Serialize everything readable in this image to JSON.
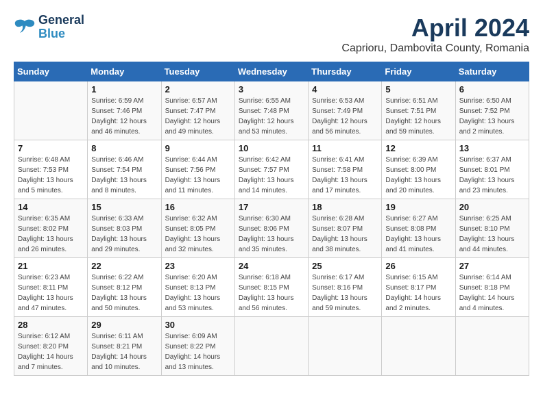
{
  "header": {
    "logo_line1": "General",
    "logo_line2": "Blue",
    "month": "April 2024",
    "location": "Caprioru, Dambovita County, Romania"
  },
  "weekdays": [
    "Sunday",
    "Monday",
    "Tuesday",
    "Wednesday",
    "Thursday",
    "Friday",
    "Saturday"
  ],
  "weeks": [
    [
      null,
      {
        "day": 1,
        "sunrise": "6:59 AM",
        "sunset": "7:46 PM",
        "daylight": "12 hours and 46 minutes."
      },
      {
        "day": 2,
        "sunrise": "6:57 AM",
        "sunset": "7:47 PM",
        "daylight": "12 hours and 49 minutes."
      },
      {
        "day": 3,
        "sunrise": "6:55 AM",
        "sunset": "7:48 PM",
        "daylight": "12 hours and 53 minutes."
      },
      {
        "day": 4,
        "sunrise": "6:53 AM",
        "sunset": "7:49 PM",
        "daylight": "12 hours and 56 minutes."
      },
      {
        "day": 5,
        "sunrise": "6:51 AM",
        "sunset": "7:51 PM",
        "daylight": "12 hours and 59 minutes."
      },
      {
        "day": 6,
        "sunrise": "6:50 AM",
        "sunset": "7:52 PM",
        "daylight": "13 hours and 2 minutes."
      }
    ],
    [
      {
        "day": 7,
        "sunrise": "6:48 AM",
        "sunset": "7:53 PM",
        "daylight": "13 hours and 5 minutes."
      },
      {
        "day": 8,
        "sunrise": "6:46 AM",
        "sunset": "7:54 PM",
        "daylight": "13 hours and 8 minutes."
      },
      {
        "day": 9,
        "sunrise": "6:44 AM",
        "sunset": "7:56 PM",
        "daylight": "13 hours and 11 minutes."
      },
      {
        "day": 10,
        "sunrise": "6:42 AM",
        "sunset": "7:57 PM",
        "daylight": "13 hours and 14 minutes."
      },
      {
        "day": 11,
        "sunrise": "6:41 AM",
        "sunset": "7:58 PM",
        "daylight": "13 hours and 17 minutes."
      },
      {
        "day": 12,
        "sunrise": "6:39 AM",
        "sunset": "8:00 PM",
        "daylight": "13 hours and 20 minutes."
      },
      {
        "day": 13,
        "sunrise": "6:37 AM",
        "sunset": "8:01 PM",
        "daylight": "13 hours and 23 minutes."
      }
    ],
    [
      {
        "day": 14,
        "sunrise": "6:35 AM",
        "sunset": "8:02 PM",
        "daylight": "13 hours and 26 minutes."
      },
      {
        "day": 15,
        "sunrise": "6:33 AM",
        "sunset": "8:03 PM",
        "daylight": "13 hours and 29 minutes."
      },
      {
        "day": 16,
        "sunrise": "6:32 AM",
        "sunset": "8:05 PM",
        "daylight": "13 hours and 32 minutes."
      },
      {
        "day": 17,
        "sunrise": "6:30 AM",
        "sunset": "8:06 PM",
        "daylight": "13 hours and 35 minutes."
      },
      {
        "day": 18,
        "sunrise": "6:28 AM",
        "sunset": "8:07 PM",
        "daylight": "13 hours and 38 minutes."
      },
      {
        "day": 19,
        "sunrise": "6:27 AM",
        "sunset": "8:08 PM",
        "daylight": "13 hours and 41 minutes."
      },
      {
        "day": 20,
        "sunrise": "6:25 AM",
        "sunset": "8:10 PM",
        "daylight": "13 hours and 44 minutes."
      }
    ],
    [
      {
        "day": 21,
        "sunrise": "6:23 AM",
        "sunset": "8:11 PM",
        "daylight": "13 hours and 47 minutes."
      },
      {
        "day": 22,
        "sunrise": "6:22 AM",
        "sunset": "8:12 PM",
        "daylight": "13 hours and 50 minutes."
      },
      {
        "day": 23,
        "sunrise": "6:20 AM",
        "sunset": "8:13 PM",
        "daylight": "13 hours and 53 minutes."
      },
      {
        "day": 24,
        "sunrise": "6:18 AM",
        "sunset": "8:15 PM",
        "daylight": "13 hours and 56 minutes."
      },
      {
        "day": 25,
        "sunrise": "6:17 AM",
        "sunset": "8:16 PM",
        "daylight": "13 hours and 59 minutes."
      },
      {
        "day": 26,
        "sunrise": "6:15 AM",
        "sunset": "8:17 PM",
        "daylight": "14 hours and 2 minutes."
      },
      {
        "day": 27,
        "sunrise": "6:14 AM",
        "sunset": "8:18 PM",
        "daylight": "14 hours and 4 minutes."
      }
    ],
    [
      {
        "day": 28,
        "sunrise": "6:12 AM",
        "sunset": "8:20 PM",
        "daylight": "14 hours and 7 minutes."
      },
      {
        "day": 29,
        "sunrise": "6:11 AM",
        "sunset": "8:21 PM",
        "daylight": "14 hours and 10 minutes."
      },
      {
        "day": 30,
        "sunrise": "6:09 AM",
        "sunset": "8:22 PM",
        "daylight": "14 hours and 13 minutes."
      },
      null,
      null,
      null,
      null
    ]
  ]
}
